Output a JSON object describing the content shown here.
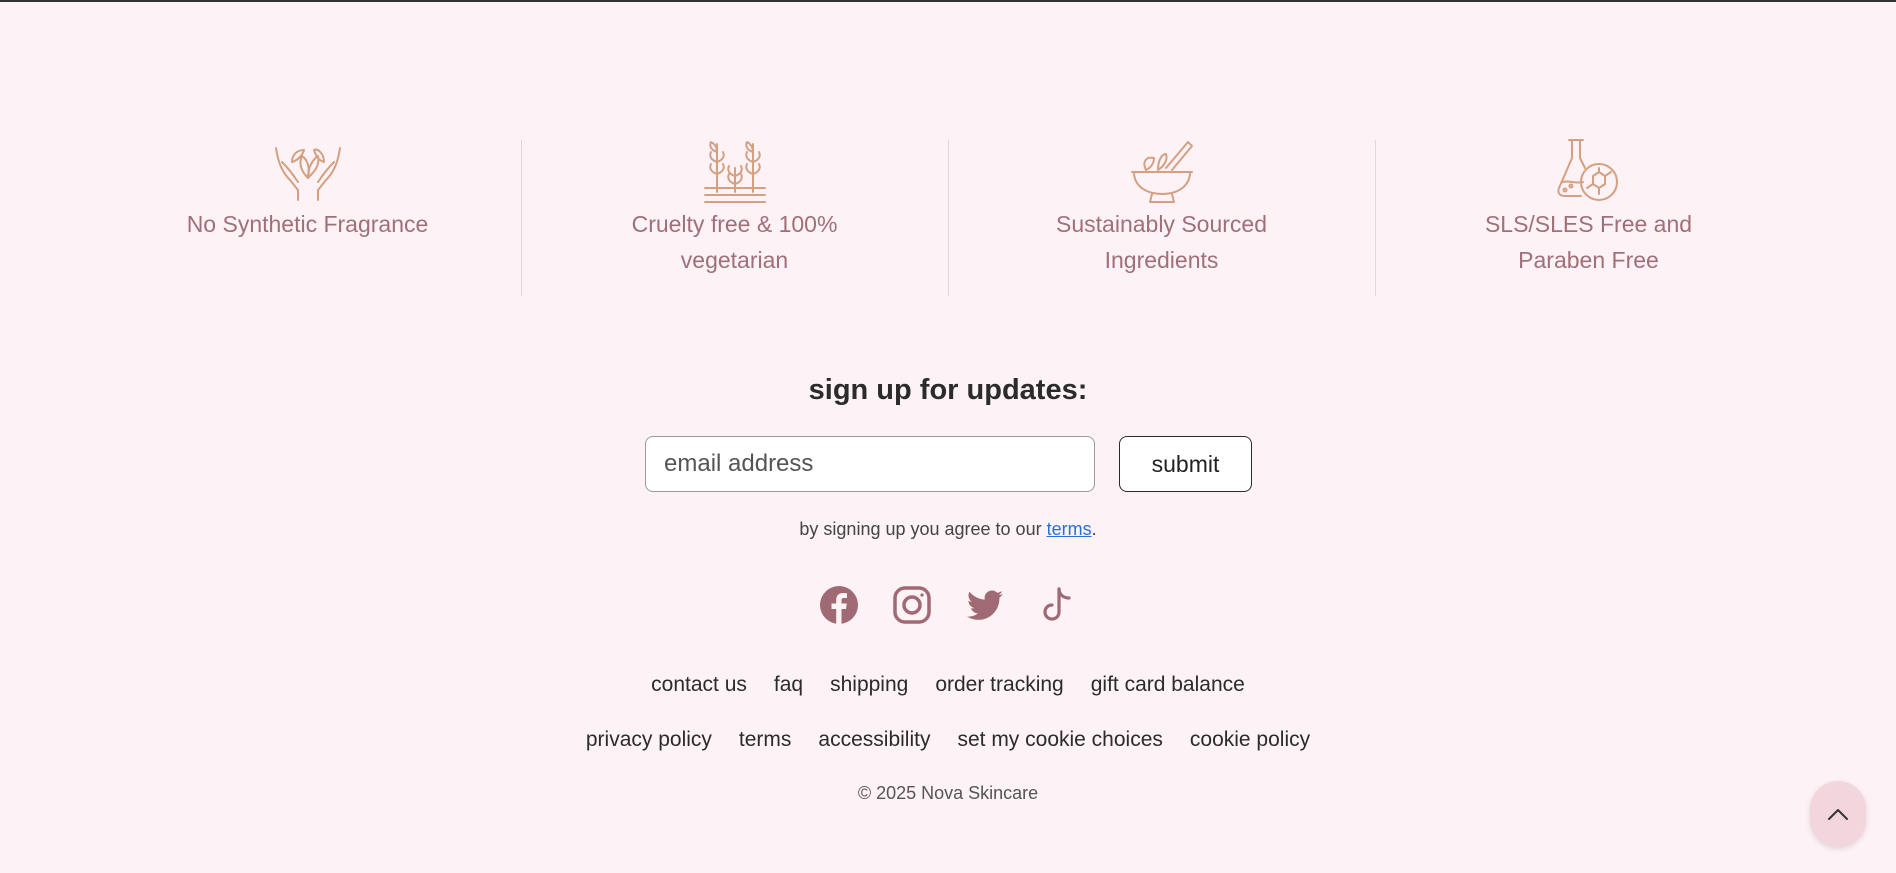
{
  "colors": {
    "background": "#fdf2f5",
    "feature_icon": "#d4a082",
    "feature_text": "#a0707a",
    "social_icon": "#a06a75",
    "link": "#2a6fd6"
  },
  "features": [
    {
      "icon": "hands-leaves-icon",
      "label": "No Synthetic Fragrance"
    },
    {
      "icon": "plants-icon",
      "label": "Cruelty free & 100% vegetarian"
    },
    {
      "icon": "mortar-bowl-icon",
      "label": "Sustainably Sourced Ingredients"
    },
    {
      "icon": "flask-molecule-icon",
      "label": "SLS/SLES Free and Paraben Free"
    }
  ],
  "signup": {
    "title": "sign up for updates:",
    "email_placeholder": "email address",
    "submit_label": "submit",
    "agree_prefix": "by signing up you agree to our ",
    "agree_link": "terms",
    "agree_suffix": "."
  },
  "social": [
    {
      "icon": "facebook-icon"
    },
    {
      "icon": "instagram-icon"
    },
    {
      "icon": "twitter-icon"
    },
    {
      "icon": "tiktok-icon"
    }
  ],
  "footer_links": {
    "row1": [
      "contact us",
      "faq",
      "shipping",
      "order tracking",
      "gift card balance"
    ],
    "row2": [
      "privacy policy",
      "terms",
      "accessibility",
      "set my cookie choices",
      "cookie policy"
    ]
  },
  "copyright": "© 2025 Nova Skincare",
  "back_to_top_icon": "chevron-up-icon"
}
